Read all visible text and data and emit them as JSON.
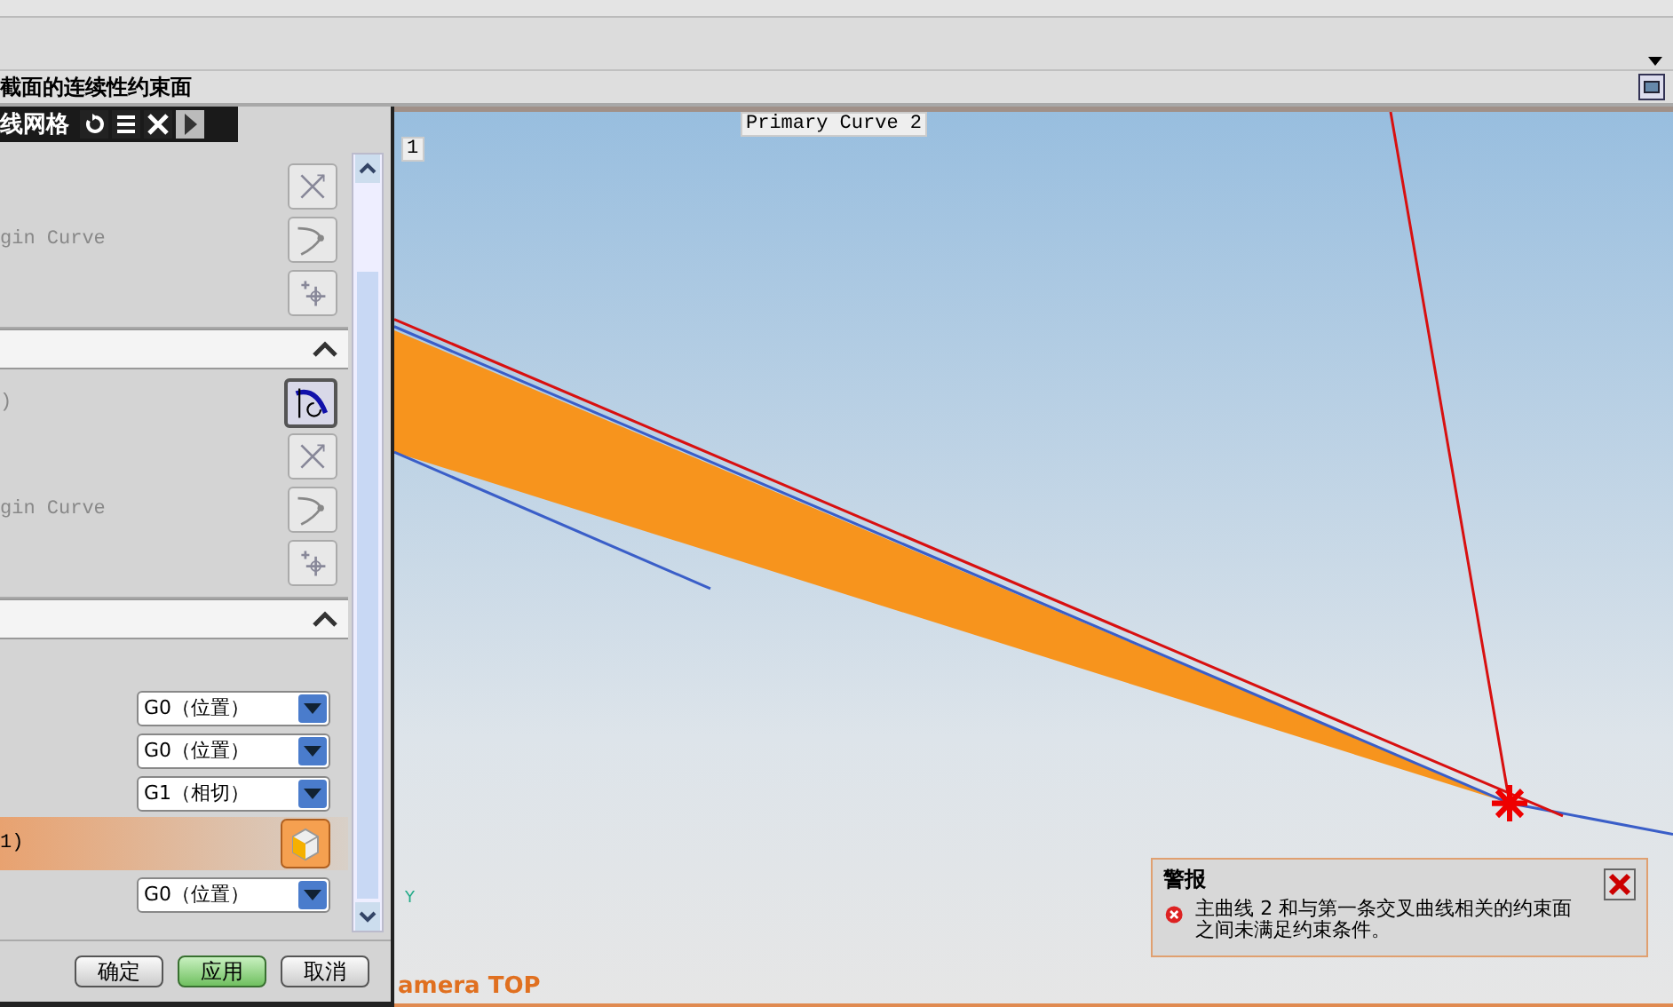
{
  "cue_line": {
    "text": "截面的连续性约束面"
  },
  "dialog": {
    "title": "线网格",
    "sections": [
      {
        "rows": [
          {
            "kind": "cross",
            "selected": false
          },
          {
            "text": "gin Curve",
            "kind": "curve",
            "selected": false
          },
          {
            "kind": "point",
            "selected": false
          }
        ]
      },
      {
        "collapsed": false,
        "rows": [
          {
            "text": ")",
            "kind": "select",
            "selected": true
          },
          {
            "kind": "cross",
            "selected": false
          },
          {
            "text": "gin Curve",
            "kind": "curve",
            "selected": false
          },
          {
            "kind": "point",
            "selected": false
          }
        ]
      }
    ],
    "continuity": [
      {
        "kind": "dropdown",
        "value": "G0（位置）",
        "selected": false
      },
      {
        "kind": "dropdown",
        "value": "G0（位置）",
        "selected": false
      },
      {
        "kind": "dropdown",
        "value": "G1（相切）",
        "selected": false
      },
      {
        "kind": "face",
        "text": "1)",
        "selected": true
      },
      {
        "kind": "dropdown",
        "value": "G0（位置）",
        "selected": false
      }
    ],
    "buttons": [
      {
        "label": "确定",
        "default": false
      },
      {
        "label": "应用",
        "default": true
      },
      {
        "label": "取消",
        "default": false
      }
    ]
  },
  "viewport": {
    "curve_label": "Primary Curve  2",
    "marker_label": "1",
    "axis_label": "Y",
    "view_name": "amera TOP"
  },
  "alert": {
    "title": "警报",
    "message": "主曲线 2 和与第一条交叉曲线相关的约束面之间未满足约束条件。"
  }
}
